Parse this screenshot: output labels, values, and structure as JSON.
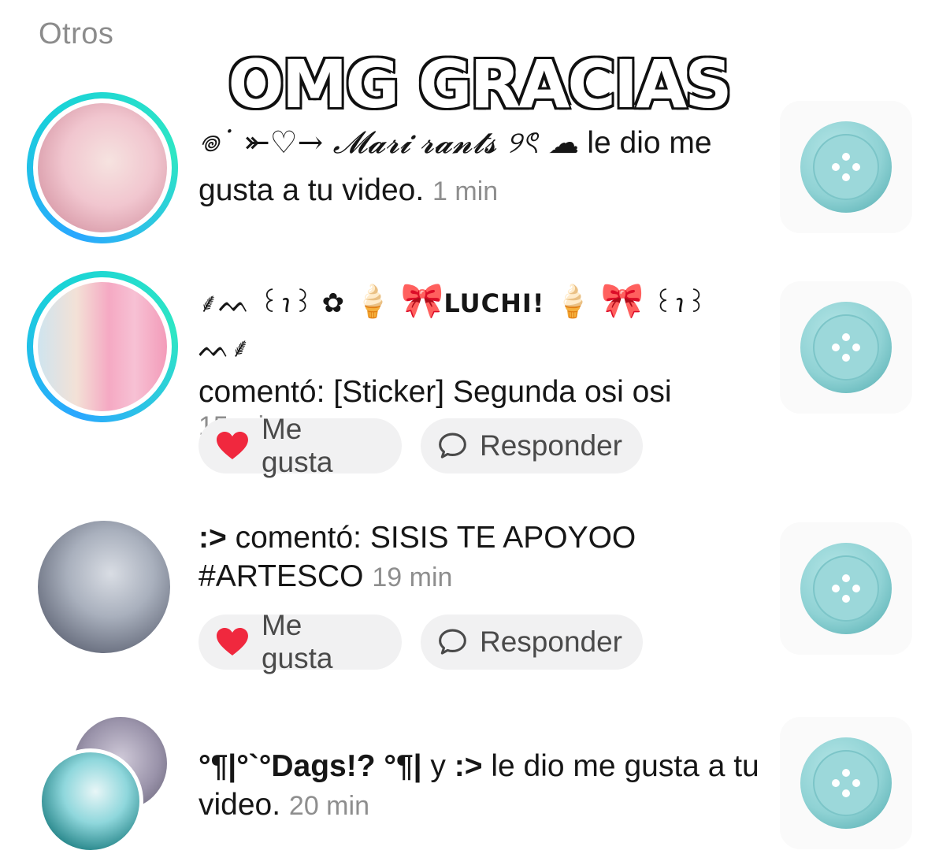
{
  "section_label": "Otros",
  "overlay_title": "OMG GRACIAS",
  "notifications": [
    {
      "user": "𖦹˙ ⤜♡→ 𝓜𝓪𝓻𝓲 𝓻𝓪𝓷𝓽𝓼 ୨ৎ ☁",
      "action": " le dio me gusta a tu video.",
      "time": "1 min"
    },
    {
      "user_prefix": "⸙ᨓ ꒰ꪱ꒱ ✿",
      "user": "LUCHI!",
      "user_suffix": "꒰ꪱ꒱ ᨓ⸙",
      "action": "comentó: [Sticker] Segunda osi osi",
      "time": "15 min",
      "like_label": "Me gusta",
      "reply_label": "Responder"
    },
    {
      "user": ":>",
      "action": " comentó: SISIS TE APOYOO #ARTESCO",
      "time": "19 min",
      "like_label": "Me gusta",
      "reply_label": "Responder"
    },
    {
      "user": "°¶|°`°Dags!? °¶|",
      "connector": " y ",
      "user2": ":>",
      "action": " le dio me gusta a tu video.",
      "time": "20 min"
    }
  ],
  "icons": {
    "like": "heart-icon",
    "reply": "speech-bubble-icon",
    "thumbnail": "button-icon"
  },
  "colors": {
    "heart": "#f0283e",
    "thumbnail_button": "#8fd2d4",
    "ring_gradient_start": "#2aa7ff",
    "ring_gradient_end": "#2ee6c4"
  }
}
